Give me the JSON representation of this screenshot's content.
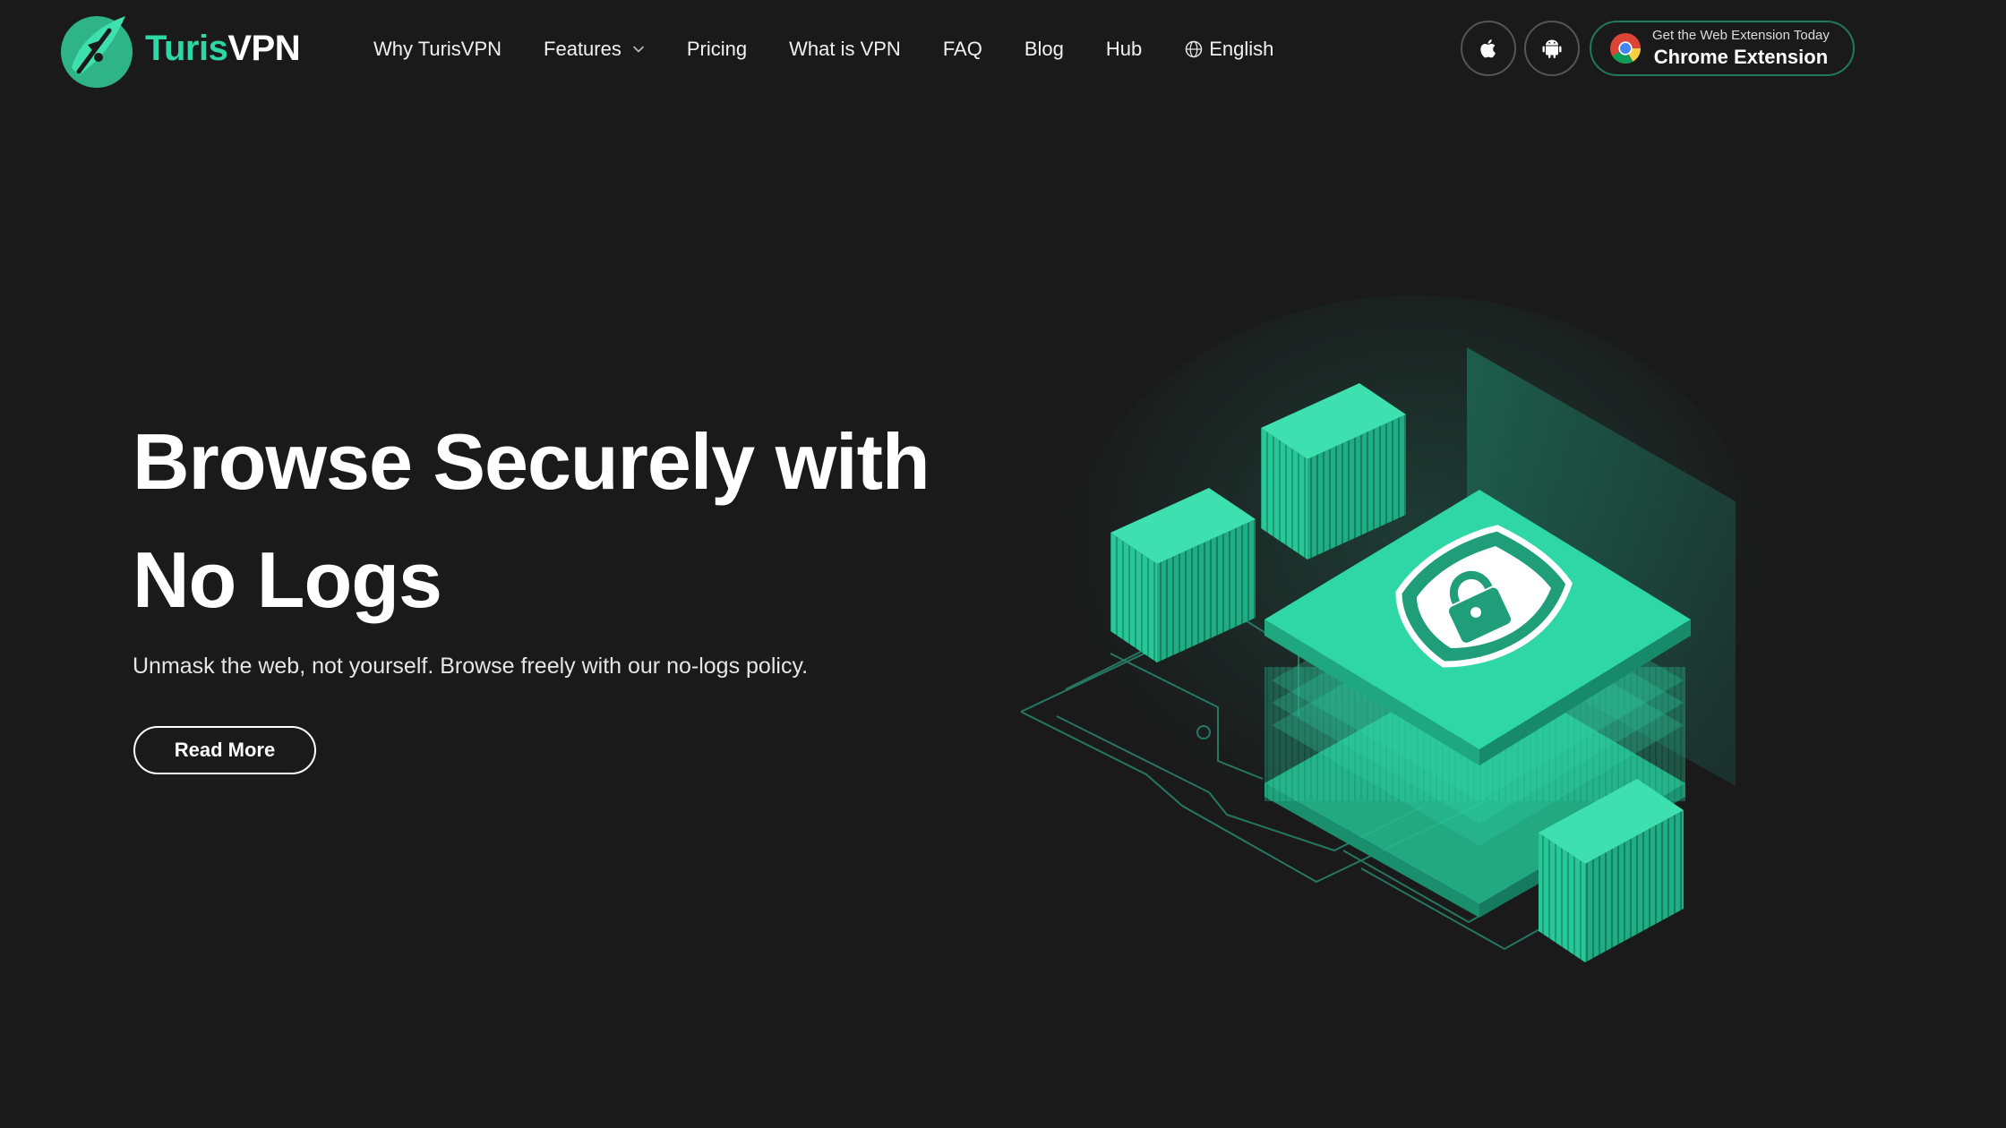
{
  "header": {
    "logo": {
      "brand_part1": "Turis",
      "brand_part2": "VPN",
      "icon": "compass-leaf-logo"
    },
    "nav": [
      {
        "label": "Why TurisVPN"
      },
      {
        "label": "Features",
        "has_dropdown": true,
        "icon": "chevron-down-icon"
      },
      {
        "label": "Pricing"
      },
      {
        "label": "What is VPN"
      },
      {
        "label": "FAQ"
      },
      {
        "label": "Blog"
      },
      {
        "label": "Hub"
      },
      {
        "label": "English",
        "icon": "globe-icon"
      }
    ],
    "store_buttons": [
      {
        "icon": "apple-icon"
      },
      {
        "icon": "android-icon"
      }
    ],
    "chrome_extension": {
      "small_text": "Get the Web Extension Today",
      "label": "Chrome Extension",
      "icon": "chrome-icon"
    }
  },
  "hero": {
    "title_line1": "Browse Securely with",
    "title_line2": "No Logs",
    "subtitle": "Unmask the web, not yourself. Browse freely with our no-logs policy.",
    "cta_label": "Read More",
    "illustration": "isometric-server-shield-illustration"
  },
  "colors": {
    "background": "#1a1a1a",
    "accent": "#2fd6a6",
    "accent_dark": "#1f7a5d",
    "text": "#ffffff"
  }
}
